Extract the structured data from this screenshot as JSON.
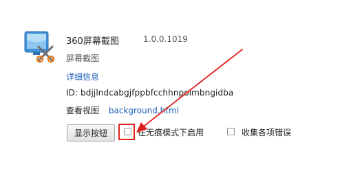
{
  "extension": {
    "name": "360屏幕截图",
    "version": "1.0.0.1019",
    "description": "屏幕截图",
    "details_link": "详细信息",
    "id_label": "ID:",
    "id_value": "bdjjlndcabgjfppbfcchhnpoimbngidba",
    "views_label": "查看视图",
    "views_link": "background.html"
  },
  "controls": {
    "show_button": "显示按钮",
    "incognito_checkbox": {
      "label": "在无痕模式下启用",
      "checked": false
    },
    "errors_checkbox": {
      "label": "收集各项错误",
      "checked": false
    }
  },
  "colors": {
    "link": "#1a5eb8",
    "annotation": "#e0201b"
  }
}
